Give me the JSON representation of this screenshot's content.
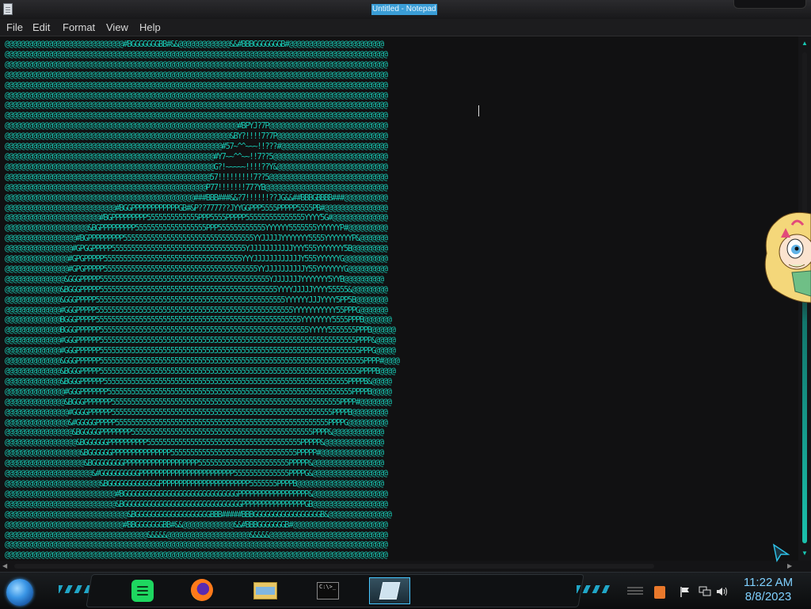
{
  "window": {
    "title": "Untitled - Notepad",
    "icon": "notepad-icon"
  },
  "menu": {
    "items": [
      "File",
      "Edit",
      "Format",
      "View",
      "Help"
    ]
  },
  "editor": {
    "content": "@@@@@@@@@@@@@@@@@@@@@@@@@@@@@@#BGGGGGGGBB#&&@@@@@@@@@@@@@&&#BBBGGGGGGGB#@@@@@@@@@@@@@@@@@@@@@@@@\n@@@@@@@@@@@@@@@@@@@@@@@@@@@@@@@@@@@@@@@@@@@@@@@@@@@@@@@@@@@@@@@@@@@@@@@@@@@@@@@@@@@@@@@@@@@@@@@@@\n@@@@@@@@@@@@@@@@@@@@@@@@@@@@@@@@@@@@@@@@@@@@@@@@@@@@@@@@@@@@@@@@@@@@@@@@@@@@@@@@@@@@@@@@@@@@@@@@@\n@@@@@@@@@@@@@@@@@@@@@@@@@@@@@@@@@@@@@@@@@@@@@@@@@@@@@@@@@@@@@@@@@@@@@@@@@@@@@@@@@@@@@@@@@@@@@@@@@\n@@@@@@@@@@@@@@@@@@@@@@@@@@@@@@@@@@@@@@@@@@@@@@@@@@@@@@@@@@@@@@@@@@@@@@@@@@@@@@@@@@@@@@@@@@@@@@@@@\n@@@@@@@@@@@@@@@@@@@@@@@@@@@@@@@@@@@@@@@@@@@@@@@@@@@@@@@@@@@@@@@@@@@@@@@@@@@@@@@@@@@@@@@@@@@@@@@@@\n@@@@@@@@@@@@@@@@@@@@@@@@@@@@@@@@@@@@@@@@@@@@@@@@@@@@@@@@@@@@@@@@@@@@@@@@@@@@@@@@@@@@@@@@@@@@@@@@@\n@@@@@@@@@@@@@@@@@@@@@@@@@@@@@@@@@@@@@@@@@@@@@@@@@@@@@@@@@@@@@@@@@@@@@@@@@@@@@@@@@@@@@@@@@@@@@@@@@\n@@@@@@@@@@@@@@@@@@@@@@@@@@@@@@@@@@@@@@@@@@@@@@@@@@@@@@@@@@@#BPYJ?7P@@@@@@@@@@@@@@@@@@@@@@@@@@@@@@\n@@@@@@@@@@@@@@@@@@@@@@@@@@@@@@@@@@@@@@@@@@@@@@@@@@@@@@@@@&BY?!!!!7?7P@@@@@@@@@@@@@@@@@@@@@@@@@@@@\n@@@@@@@@@@@@@@@@@@@@@@@@@@@@@@@@@@@@@@@@@@@@@@@@@@@@@@@#57~^^~~~!!???#@@@@@@@@@@@@@@@@@@@@@@@@@@@\n@@@@@@@@@@@@@@@@@@@@@@@@@@@@@@@@@@@@@@@@@@@@@@@@@@@@@#Y7~~^^~~!!7??5@@@@@@@@@@@@@@@@@@@@@@@@@@@@@\n@@@@@@@@@@@@@@@@@@@@@@@@@@@@@@@@@@@@@@@@@@@@@@@@@@@@@G?!~~~~~!!!!??Y&@@@@@@@@@@@@@@@@@@@@@@@@@@@@\n@@@@@@@@@@@@@@@@@@@@@@@@@@@@@@@@@@@@@@@@@@@@@@@@@@@@57!!!!!!!!!7??5@@@@@@@@@@@@@@@@@@@@@@@@@@@@@@\n@@@@@@@@@@@@@@@@@@@@@@@@@@@@@@@@@@@@@@@@@@@@@@@@@@@P77!!!!!!!77?YB@@@@@@@@@@@@@@@@@@@@@@@@@@@@@@@\n@@@@@@@@@@@@@@@@@@@@@@@@@@@@@@@@@@@@@@@@@@@@@@@@###BBB###&&?7!!!!!!??JG&&##BBBGBBBB###@@@@@@@@@@@\n@@@@@@@@@@@@@@@@@@@@@@@@@@@@#BGGPPPPPPPPPPPPGB#&P??7777??JYYGGPPP5555PPPPP5555PB#@@@@@@@@@@@@@@@@\n@@@@@@@@@@@@@@@@@@@@@@@@#BGPPPPPPPPP5555555555555PPP5555PPPPP555555555555555YYYY5G#@@@@@@@@@@@@@@\n@@@@@@@@@@@@@@@@@@@@@&BGPPPPPPPPP555555555555555555PPP555555555555YYYYYY5555555YYYYYYP#@@@@@@@@@@\n@@@@@@@@@@@@@@@@@@#BGPPPPPPPPP555555555555555555555555555555555YYJJJJJYYYYYYY5555YYYYYYYP&@@@@@@@\n@@@@@@@@@@@@@@@@@#GPGGPPPPP5555555555555555555555555555555555YJJJJJJJJJJJYYY555YYYYYYY5B@@@@@@@@@\n@@@@@@@@@@@@@@@@#GPGPPPPP55555555555555555555555555555555555YYYJJJJJJJJJJJJY555YYYYYYG@@@@@@@@@@@\n@@@@@@@@@@@@@@@@#GPGPPPPP555555555555555555555555555555555555555YYJJJJJJJJJJY55YYYYYYYG@@@@@@@@@@\n@@@@@@@@@@@@@@@&GGGPPPPP5555555555555555555555555555555555555555555YJJJJJJJYYYYYYY5YYB@@@@@@@@@@\n@@@@@@@@@@@@@@&BGGGPPPPP555555555555555555555555555555555555555555555YYYYJJJJJYYYY55555&@@@@@@@@@\n@@@@@@@@@@@@@@&GGGPPPPP555555555555555555555555555555555555555555555555YYYYYYJJJYYYY5PP5B@@@@@@@@\n@@@@@@@@@@@@@@#GGGPPPPP55555555555555555555555555555555555555555555555555YYYYYYYYYYY55PPPG@@@@@@@\n@@@@@@@@@@@@@@BGGGPPPPP5555555555555555555555555555555555555555555555555555YYYYYYYY5555PPPB@@@@@@@\n@@@@@@@@@@@@@@BGGGPPPPPP55555555555555555555555555555555555555555555555555555YYYYY5555555PPPB@@@@@@\n@@@@@@@@@@@@@@#GGGPPPPPP55555555555555555555555555555555555555555555555555555555555555555PPPP&@@@@@\n@@@@@@@@@@@@@@#GGGPPPPPP555555555555555555555555555555555555555555555555555555555555555555PPPG@@@@@\n@@@@@@@@@@@@@@&GGGPPPPPP5555555555555555555555555555555555555555555555555555555555555555555PPPP#@@@@\n@@@@@@@@@@@@@@&BGGGPPPPP555555555555555555555555555555555555555555555555555555555555555555PPPPB@@@@\n@@@@@@@@@@@@@@&BGGGPPPPPP55555555555555555555555555555555555555555555555555555555555555PPPPB&@@@@@\n@@@@@@@@@@@@@@@#GGGPPPPPPP55555555555555555555555555555555555555555555555555555555555555PPPPB@@@@@\n@@@@@@@@@@@@@@@&BGGGPPPPPPP5555555555555555555555555555555555555555555555555555555555PPPP#@@@@@@@@\n@@@@@@@@@@@@@@@@#GGGGPPPPPP55555555555555555555555555555555555555555555555555555555PPPPB@@@@@@@@@\n@@@@@@@@@@@@@@@@&#GGGGGPPPPP555555555555555555555555555555555555555555555555555555PPPPG@@@@@@@@@@\n@@@@@@@@@@@@@@@@@&BGGGGGPPPPPPPP5555555555555555555555555555555555555555555555PPPP&@@@@@@@@@@@@@\n@@@@@@@@@@@@@@@@@@&BGGGGGGPPPPPPPPPP555555555555555555555555555555555555555PPPPP&@@@@@@@@@@@@@@@\n@@@@@@@@@@@@@@@@@@@&BGGGGGGPPPPPPPPPPPPPPP55555555555555555555555555555555PPPPP#@@@@@@@@@@@@@@@@\n@@@@@@@@@@@@@@@@@@@@&BGGGGGGGGPPPPPPPPPPPPPPPPPPP55555555555555555555555PPPPP&@@@@@@@@@@@@@@@@@@\n@@@@@@@@@@@@@@@@@@@@@@&#GGGGGGGGGGPPPPPPPPPPPPPPPPPPPPPPPP55555555555555PPPPG&@@@@@@@@@@@@@@@@@@@\n@@@@@@@@@@@@@@@@@@@@@@@@&BGGGGGGGGGGGGGPPPPPPPPPPPPPPPPPPPPPPP5555555PPPPB@@@@@@@@@@@@@@@@@@@@@@\n@@@@@@@@@@@@@@@@@@@@@@@@@@@@#BGGGGGGGGGGGGGGGGGGGGGGGGGGGGGPPPPPPPPPPPPPPPPPP&@@@@@@@@@@@@@@@@@@@\n@@@@@@@@@@@@@@@@@@@@@@@@@@@@&BGGGGGGGGGGGGGGGGGGGGGGGGGGGGGGPPPPPPPPPPPPPPPPGB@@@@@@@@@@@@@@@@@@@\n@@@@@@@@@@@@@@@@@@@@@@@@@@@@@@@&BGGGGGGGGGGGGGGGGGGGBBB#####BBBGGGGGGGGGGGGGGGGGB&@@@@@@@@@@@@@@@@\n@@@@@@@@@@@@@@@@@@@@@@@@@@@@@@#BBGGGGGGGBB#&&@@@@@@@@@@@@@&&#BBBGGGGGGGB#@@@@@@@@@@@@@@@@@@@@@@@@\n@@@@@@@@@@@@@@@@@@@@@@@@@@@@@@@@@@@@&&&&&@@@@@@@@@@@@@@@@@@@@@&&&&&@@@@@@@@@@@@@@@@@@@@@@@@@@@@@@\n@@@@@@@@@@@@@@@@@@@@@@@@@@@@@@@@@@@@@@@@@@@@@@@@@@@@@@@@@@@@@@@@@@@@@@@@@@@@@@@@@@@@@@@@@@@@@@@@@\n@@@@@@@@@@@@@@@@@@@@@@@@@@@@@@@@@@@@@@@@@@@@@@@@@@@@@@@@@@@@@@@@@@@@@@@@@@@@@@@@@@@@@@@@@@@@@@@@@",
    "text_color": "#18c9b4",
    "background": "#111112"
  },
  "taskbar": {
    "start_icon": "start-orb-icon",
    "pinned": [
      {
        "name": "spotify",
        "icon": "spotify-icon"
      },
      {
        "name": "firefox",
        "icon": "firefox-icon"
      },
      {
        "name": "file-explorer",
        "icon": "folder-icon"
      },
      {
        "name": "command-prompt",
        "icon": "terminal-icon",
        "glyph": "C:\\>_"
      },
      {
        "name": "notepad",
        "icon": "notepad-icon",
        "active": true
      }
    ],
    "tray": {
      "icons": [
        "tray-overflow-icon",
        "java-icon",
        "action-center-flag-icon",
        "network-icon",
        "volume-icon"
      ],
      "time": "11:22 AM",
      "date": "8/8/2023"
    },
    "accent": "#23c0e6"
  }
}
